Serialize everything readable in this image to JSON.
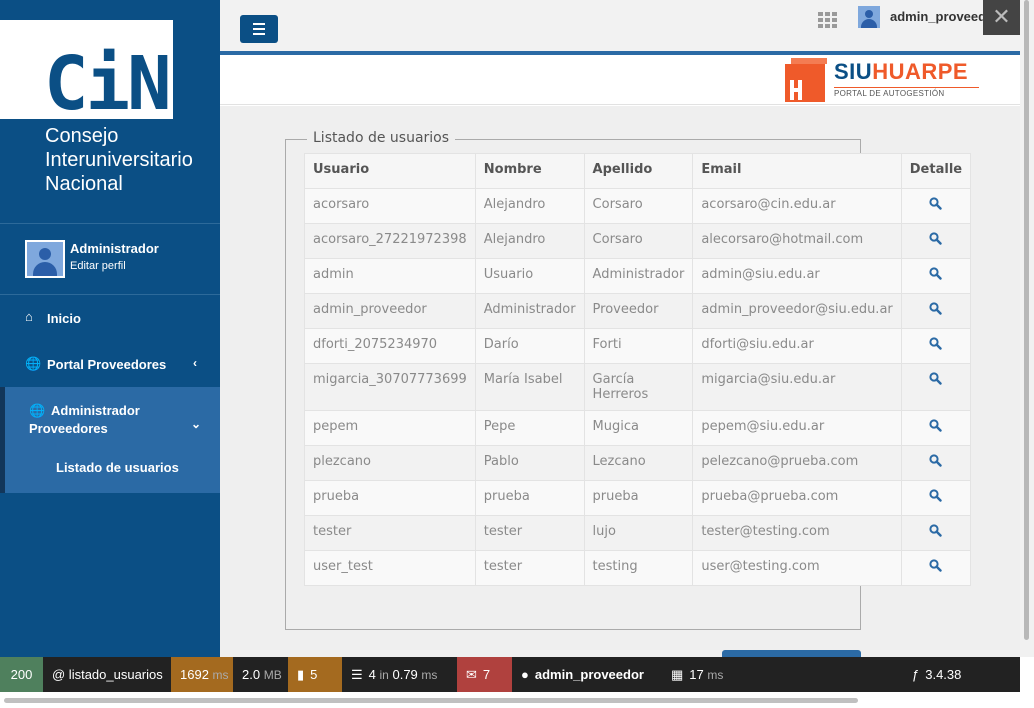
{
  "sidebar": {
    "logo_text": "CiN",
    "org_name_lines": [
      "Consejo",
      "Interuniversitario",
      "Nacional"
    ],
    "user": {
      "name": "Administrador",
      "edit_label": "Editar perfil"
    },
    "nav": [
      {
        "label": "Inicio",
        "icon": "home-icon"
      },
      {
        "label": "Portal Proveedores",
        "icon": "globe-icon",
        "chevron": "‹"
      },
      {
        "label_line1": "Administrador",
        "label_line2": "Proveedores",
        "icon": "globe-icon",
        "chevron": "⌄"
      }
    ],
    "submenu": [
      {
        "label": "Listado de usuarios"
      }
    ],
    "colors": {
      "background": "#0b4f85",
      "active": "#2b6aa5"
    }
  },
  "topbar": {
    "menu_button": "menu-icon",
    "apps_icon": "apps-grid-icon",
    "username": "admin_proveedor"
  },
  "brand": {
    "title_part1": "SIU",
    "title_part2": "HUARPE",
    "subtitle": "PORTAL DE AUTOGESTIÓN",
    "colors": {
      "blue": "#0b4f85",
      "orange": "#ef5a2a"
    }
  },
  "content": {
    "legend": "Listado de usuarios",
    "columns": [
      "Usuario",
      "Nombre",
      "Apellido",
      "Email",
      "Detalle"
    ],
    "rows": [
      {
        "usuario": "acorsaro",
        "nombre": "Alejandro",
        "apellido": "Corsaro",
        "email": "acorsaro@cin.edu.ar"
      },
      {
        "usuario": "acorsaro_27221972398",
        "nombre": "Alejandro",
        "apellido": "Corsaro",
        "email": "alecorsaro@hotmail.com"
      },
      {
        "usuario": "admin",
        "nombre": "Usuario",
        "apellido": "Administrador",
        "email": "admin@siu.edu.ar"
      },
      {
        "usuario": "admin_proveedor",
        "nombre": "Administrador",
        "apellido": "Proveedor",
        "email": "admin_proveedor@siu.edu.ar"
      },
      {
        "usuario": "dforti_2075234970",
        "nombre": "Darío",
        "apellido": "Forti",
        "email": "dforti@siu.edu.ar"
      },
      {
        "usuario": "migarcia_30707773699",
        "nombre": "María Isabel",
        "apellido": "García Herreros",
        "email": "migarcia@siu.edu.ar"
      },
      {
        "usuario": "pepem",
        "nombre": "Pepe",
        "apellido": "Mugica",
        "email": "pepem@siu.edu.ar"
      },
      {
        "usuario": "plezcano",
        "nombre": "Pablo",
        "apellido": "Lezcano",
        "email": "pelezcano@prueba.com"
      },
      {
        "usuario": "prueba",
        "nombre": "prueba",
        "apellido": "prueba",
        "email": "prueba@prueba.com"
      },
      {
        "usuario": "tester",
        "nombre": "tester",
        "apellido": "lujo",
        "email": "tester@testing.com"
      },
      {
        "usuario": "user_test",
        "nombre": "tester",
        "apellido": "testing",
        "email": "user@testing.com"
      }
    ],
    "detail_icon": "search-icon"
  },
  "debug_toolbar": {
    "status": "200",
    "route": "@ listado_usuarios",
    "time_value": "1692",
    "time_unit": "ms",
    "memory_value": "2.0",
    "memory_unit": "MB",
    "logs_count": "5",
    "queries_count": "4",
    "queries_in": "in",
    "queries_time": "0.79",
    "queries_unit": "ms",
    "translations_count": "7",
    "user": "admin_proveedor",
    "render_time": "17",
    "render_unit": "ms",
    "version": "3.4.38",
    "colors": {
      "status": "#4f805d",
      "time": "#a46a1f",
      "logs": "#a46a1f",
      "translations": "#b0413e",
      "bar": "#222222"
    }
  }
}
